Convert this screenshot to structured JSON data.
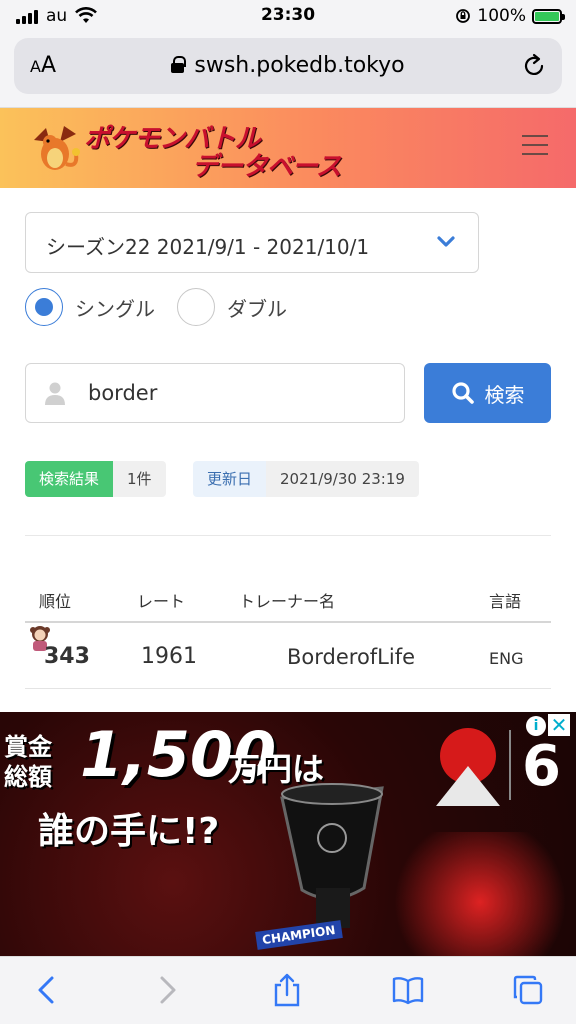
{
  "status_bar": {
    "carrier": "au",
    "time": "23:30",
    "battery_percent": "100%",
    "battery_level": 1.0
  },
  "browser": {
    "aa_label_small": "A",
    "aa_label_big": "A",
    "url": "swsh.pokedb.tokyo",
    "icons": [
      "lock-icon",
      "reload-icon"
    ]
  },
  "header": {
    "logo_line1": "ポケモンバトル",
    "logo_line2": "データベース",
    "menu_icon": "hamburger-icon"
  },
  "filters": {
    "season_selected": "シーズン22  2021/9/1 - 2021/10/1",
    "battle_types": [
      {
        "label": "シングル",
        "selected": true
      },
      {
        "label": "ダブル",
        "selected": false
      }
    ]
  },
  "search": {
    "value": "border",
    "button_label": "検索"
  },
  "result_info": {
    "count_label": "検索結果",
    "count_value": "1件",
    "updated_label": "更新日",
    "updated_value": "2021/9/30 23:19"
  },
  "table": {
    "headers": [
      "順位",
      "レート",
      "トレーナー名",
      "言語"
    ],
    "rows": [
      {
        "rank": "343",
        "rate": "1961",
        "trainer": "BorderofLife",
        "lang": "ENG"
      }
    ]
  },
  "ad": {
    "line_small": "賞金\n総額",
    "amount": "1,500",
    "unit": "万円は",
    "question": "誰の手に!?",
    "logo_number": "6",
    "banner": "CHAMPION",
    "info_icon": "i",
    "close_icon": "✕"
  },
  "toolbar": {
    "icons": [
      "back-icon",
      "forward-icon",
      "share-icon",
      "bookmarks-icon",
      "tabs-icon"
    ]
  },
  "colors": {
    "accent": "#3b7dd8",
    "success": "#48c774",
    "header_gradient_start": "#fbc25a",
    "header_gradient_end": "#f56a6a",
    "logo_text": "#c8102e"
  }
}
